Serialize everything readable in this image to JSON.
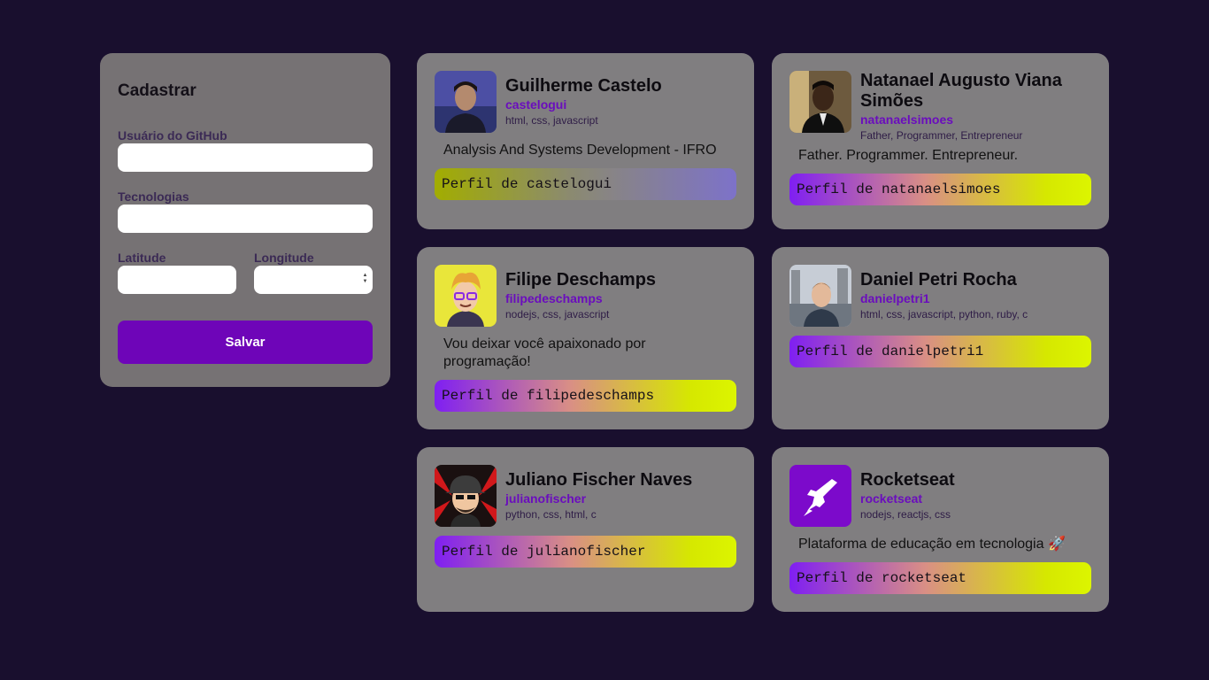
{
  "form": {
    "title": "Cadastrar",
    "github_label": "Usuário do GitHub",
    "github_value": "",
    "techs_label": "Tecnologias",
    "techs_value": "",
    "latitude_label": "Latitude",
    "latitude_value": "",
    "longitude_label": "Longitude",
    "longitude_value": "",
    "submit_label": "Salvar"
  },
  "devs": [
    {
      "name": "Guilherme Castelo",
      "username": "castelogui",
      "techs": "html, css, javascript",
      "bio": "Analysis And Systems Development - IFRO",
      "link": "Perfil de castelogui"
    },
    {
      "name": "Natanael Augusto Viana Simões",
      "username": "natanaelsimoes",
      "techs": "Father, Programmer, Entrepreneur",
      "bio": "Father. Programmer. Entrepreneur.",
      "link": "Perfil de natanaelsimoes"
    },
    {
      "name": "Filipe Deschamps",
      "username": "filipedeschamps",
      "techs": "nodejs, css, javascript",
      "bio": "Vou deixar você apaixonado por programação!",
      "link": "Perfil de filipedeschamps"
    },
    {
      "name": "Daniel Petri Rocha",
      "username": "danielpetri1",
      "techs": "html, css, javascript, python, ruby, c",
      "bio": "",
      "link": "Perfil de danielpetri1"
    },
    {
      "name": "Juliano Fischer Naves",
      "username": "julianofischer",
      "techs": "python, css, html, c",
      "bio": "",
      "link": "Perfil de julianofischer"
    },
    {
      "name": "Rocketseat",
      "username": "rocketseat",
      "techs": "nodejs, reactjs, css",
      "bio": "Plataforma de educação em tecnologia 🚀",
      "link": "Perfil de rocketseat"
    }
  ],
  "colors": {
    "background": "#190f2e",
    "accent": "#6e05b8",
    "username": "#6a0dbd",
    "card": "#807e80"
  }
}
